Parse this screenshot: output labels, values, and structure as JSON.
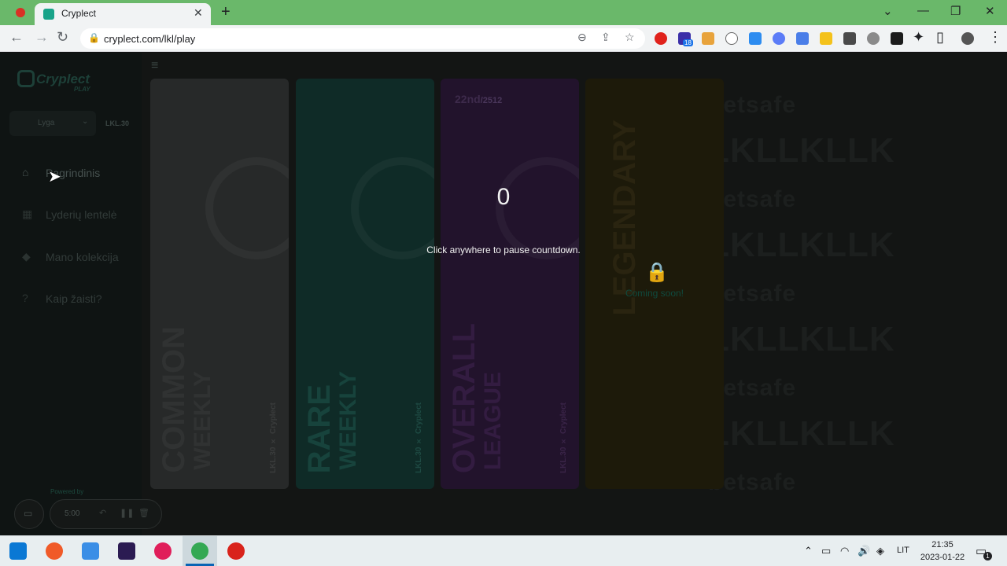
{
  "browser": {
    "tab_title": "Cryplect",
    "url": "cryplect.com/lkl/play",
    "extension_badge": "18"
  },
  "sidebar": {
    "logo_text": "Cryplect",
    "logo_sub": "PLAY",
    "league_select": "Lyga",
    "league_tag": "LKL.30",
    "items": [
      {
        "label": "Pagrindinis",
        "icon": "home-icon"
      },
      {
        "label": "Lyderių lentelė",
        "icon": "calendar-icon"
      },
      {
        "label": "Mano kolekcija",
        "icon": "collection-icon"
      },
      {
        "label": "Kaip žaisti?",
        "icon": "help-icon"
      }
    ]
  },
  "cards": {
    "common": {
      "title": "COMMON",
      "sub": "WEEKLY",
      "brand": "LKL.30 × Cryplect"
    },
    "rare": {
      "title": "RARE",
      "sub": "WEEKLY",
      "brand": "LKL.30 × Cryplect"
    },
    "overall": {
      "title": "OVERALL",
      "sub": "LEAGUE",
      "brand": "LKL.30 × Cryplect",
      "rank": "22nd",
      "rank_total": "/2512"
    },
    "legendary": {
      "title": "LEGENDARY",
      "status": "Coming soon!"
    }
  },
  "watermark": {
    "brand": "betsafe",
    "lkl": "LKLLKLLK"
  },
  "countdown": {
    "value": "0",
    "hint": "Click anywhere to pause countdown."
  },
  "recorder": {
    "powered_by": "Powered by",
    "time": "5:00"
  },
  "taskbar": {
    "language": "LIT",
    "time": "21:35",
    "date": "2023-01-22",
    "notifications": "1"
  },
  "colors": {
    "chrome_green": "#6ab86a",
    "accent_teal": "#18a389",
    "taskbar_accent": "#0a64b4"
  }
}
